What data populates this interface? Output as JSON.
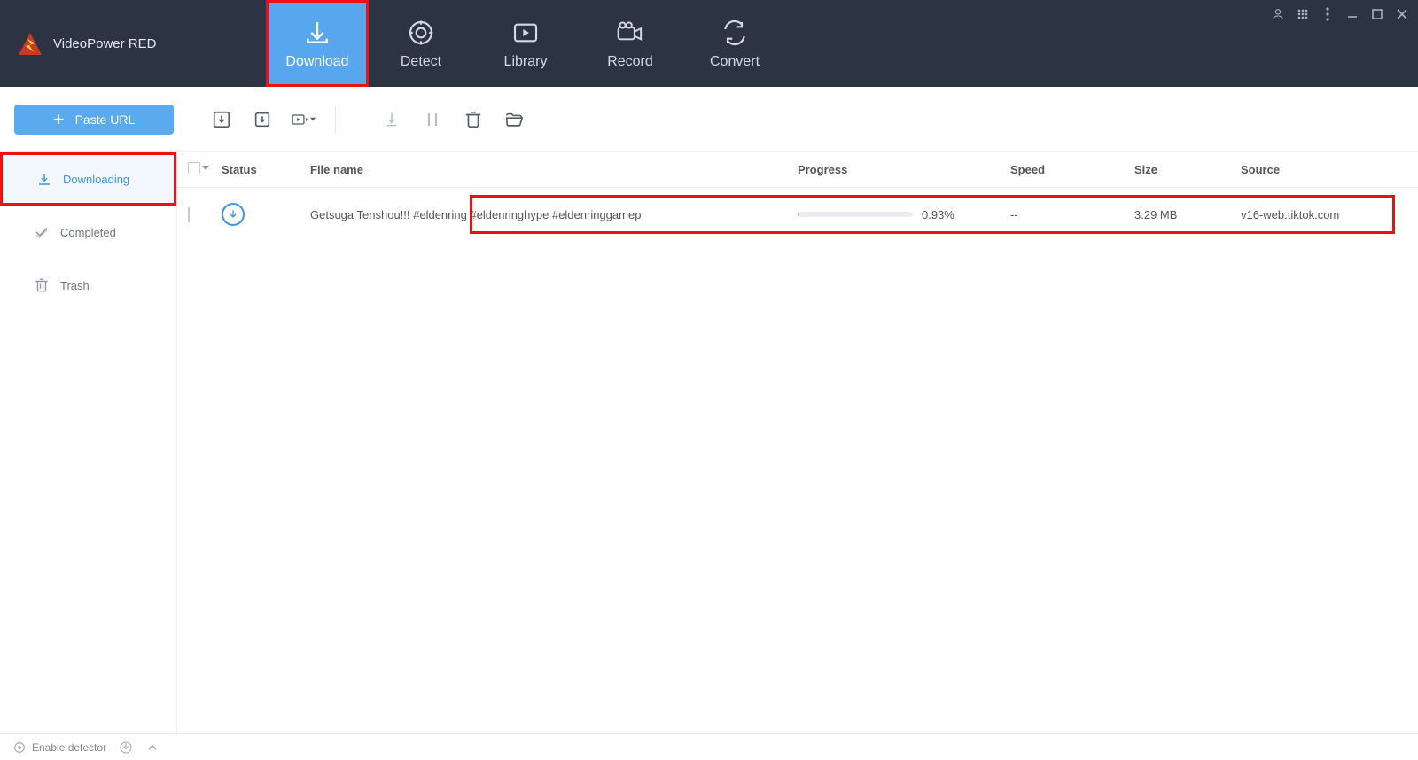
{
  "app": {
    "title": "VideoPower RED"
  },
  "tabs": [
    {
      "label": "Download",
      "icon": "download-icon",
      "active": true
    },
    {
      "label": "Detect",
      "icon": "detect-icon",
      "active": false
    },
    {
      "label": "Library",
      "icon": "library-icon",
      "active": false
    },
    {
      "label": "Record",
      "icon": "record-icon",
      "active": false
    },
    {
      "label": "Convert",
      "icon": "convert-icon",
      "active": false
    }
  ],
  "toolbar": {
    "paste_label": "Paste URL"
  },
  "sidebar": {
    "items": [
      {
        "label": "Downloading",
        "active": true
      },
      {
        "label": "Completed",
        "active": false
      },
      {
        "label": "Trash",
        "active": false
      }
    ]
  },
  "table": {
    "headers": {
      "status": "Status",
      "filename": "File name",
      "progress": "Progress",
      "speed": "Speed",
      "size": "Size",
      "source": "Source"
    }
  },
  "downloads": [
    {
      "filename": "Getsuga Tenshou!!! #eldenring #eldenringhype #eldenringgamep",
      "progress_pct": 0.93,
      "progress_text": "0.93%",
      "speed": "--",
      "size": "3.29 MB",
      "source": "v16-web.tiktok.com"
    }
  ],
  "footer": {
    "enable_detector": "Enable detector"
  }
}
